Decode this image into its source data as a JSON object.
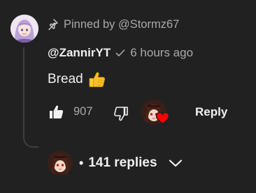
{
  "comment": {
    "pinned_text": "Pinned by @Stormz67",
    "author": "@ZannirYT",
    "time": "6 hours ago",
    "body": "Bread",
    "body_emoji": "thumbs-up-emoji",
    "like_count": "907",
    "reply_label": "Reply"
  },
  "replies": {
    "dot": "•",
    "count_text": "141 replies"
  },
  "colors": {
    "background": "#212121",
    "text_primary": "#f1f1f1",
    "text_secondary": "#aaaaaa",
    "heart_red": "#ff0000",
    "thread_line": "#3f3f3f"
  },
  "icons": [
    "pin-icon",
    "verified-check-icon",
    "like-icon",
    "dislike-icon",
    "heart-icon",
    "chevron-down-icon"
  ]
}
